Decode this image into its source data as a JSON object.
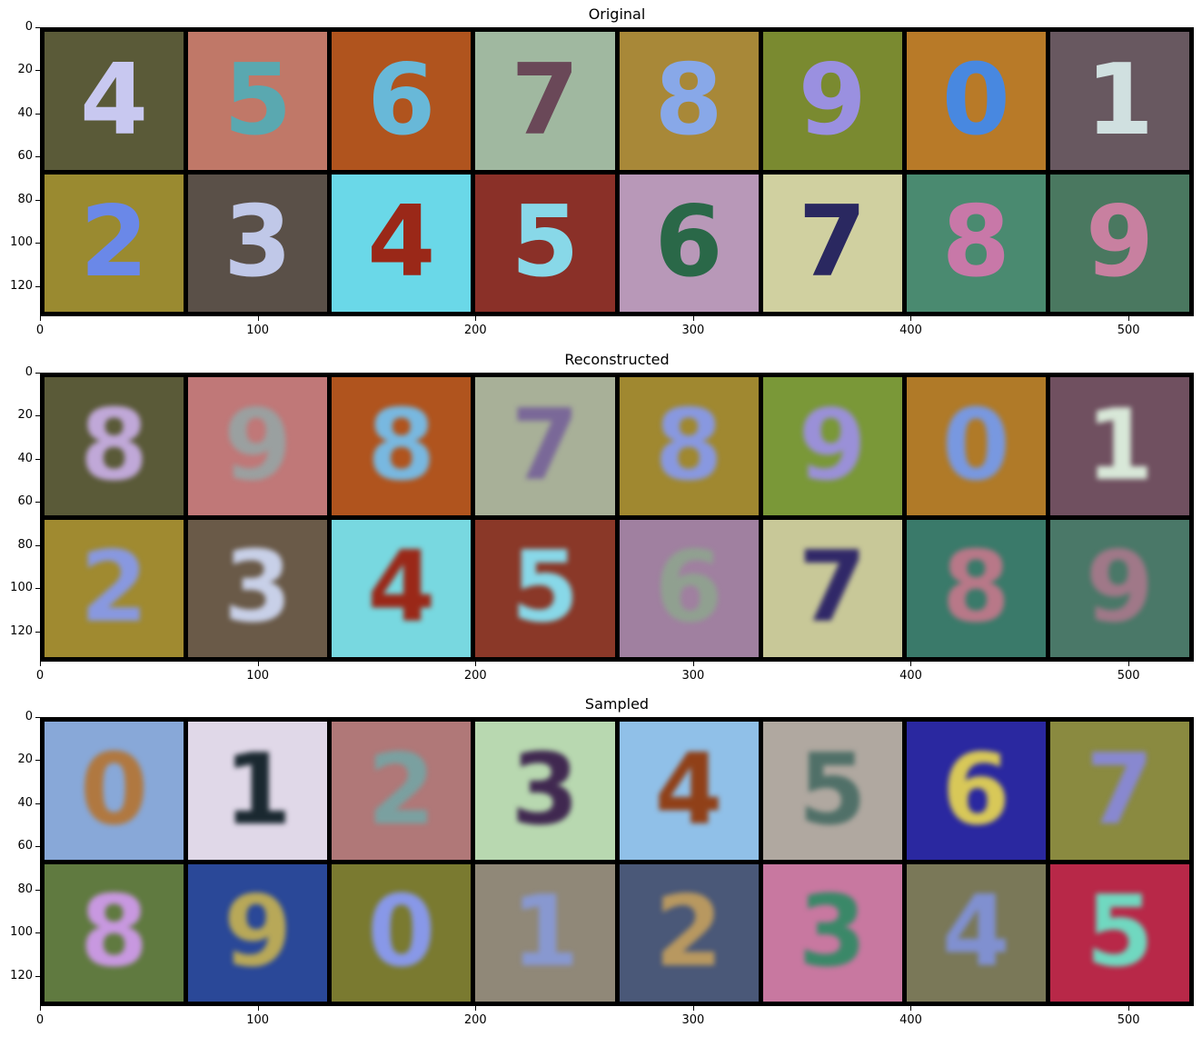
{
  "panels": [
    {
      "title": "Original",
      "y_ticks": [
        "0",
        "20",
        "40",
        "60",
        "80",
        "100",
        "120"
      ],
      "x_ticks": [
        "0",
        "100",
        "200",
        "300",
        "400",
        "500"
      ],
      "tiles": [
        {
          "digit": "4",
          "bg": "#5a5a38",
          "fg": "#c8c8f0"
        },
        {
          "digit": "5",
          "bg": "#c07868",
          "fg": "#5aa8b0"
        },
        {
          "digit": "6",
          "bg": "#b0541e",
          "fg": "#68b8d8"
        },
        {
          "digit": "7",
          "bg": "#a0b8a0",
          "fg": "#6a4858"
        },
        {
          "digit": "8",
          "bg": "#a88838",
          "fg": "#88a8e8"
        },
        {
          "digit": "9",
          "bg": "#7a8a30",
          "fg": "#9a90e0"
        },
        {
          "digit": "0",
          "bg": "#b87a28",
          "fg": "#4888e0"
        },
        {
          "digit": "1",
          "bg": "#685860",
          "fg": "#d0e0e0"
        },
        {
          "digit": "2",
          "bg": "#9a8a30",
          "fg": "#6a88e8"
        },
        {
          "digit": "3",
          "bg": "#5a5048",
          "fg": "#c0c8e8"
        },
        {
          "digit": "4",
          "bg": "#6ad8e8",
          "fg": "#9a2818"
        },
        {
          "digit": "5",
          "bg": "#8a3028",
          "fg": "#88d8e8"
        },
        {
          "digit": "6",
          "bg": "#b898b8",
          "fg": "#2a6848"
        },
        {
          "digit": "7",
          "bg": "#d0d0a0",
          "fg": "#2a2860"
        },
        {
          "digit": "8",
          "bg": "#4a8a70",
          "fg": "#c878a8"
        },
        {
          "digit": "9",
          "bg": "#4a7860",
          "fg": "#c880a0"
        }
      ]
    },
    {
      "title": "Reconstructed",
      "y_ticks": [
        "0",
        "20",
        "40",
        "60",
        "80",
        "100",
        "120"
      ],
      "x_ticks": [
        "0",
        "100",
        "200",
        "300",
        "400",
        "500"
      ],
      "tiles": [
        {
          "digit": "8",
          "bg": "#5a5a38",
          "fg": "#c0a8d8"
        },
        {
          "digit": "9",
          "bg": "#c07878",
          "fg": "#9aa0a0"
        },
        {
          "digit": "8",
          "bg": "#b0541e",
          "fg": "#78b8e0"
        },
        {
          "digit": "7",
          "bg": "#a8b098",
          "fg": "#7a6898"
        },
        {
          "digit": "8",
          "bg": "#a08830",
          "fg": "#8898e0"
        },
        {
          "digit": "9",
          "bg": "#7a9838",
          "fg": "#9a90d8"
        },
        {
          "digit": "0",
          "bg": "#b07a28",
          "fg": "#7898e0"
        },
        {
          "digit": "1",
          "bg": "#705060",
          "fg": "#d8e8d8"
        },
        {
          "digit": "2",
          "bg": "#a08a30",
          "fg": "#8898e0"
        },
        {
          "digit": "3",
          "bg": "#6a5a48",
          "fg": "#c8d0e8"
        },
        {
          "digit": "4",
          "bg": "#78d8e0",
          "fg": "#9a2818"
        },
        {
          "digit": "5",
          "bg": "#8a3828",
          "fg": "#88d8e8"
        },
        {
          "digit": "6",
          "bg": "#a080a0",
          "fg": "#90a090"
        },
        {
          "digit": "7",
          "bg": "#c8c898",
          "fg": "#302868"
        },
        {
          "digit": "8",
          "bg": "#3a7a6a",
          "fg": "#b87888"
        },
        {
          "digit": "9",
          "bg": "#4a7868",
          "fg": "#a07888"
        }
      ]
    },
    {
      "title": "Sampled",
      "y_ticks": [
        "0",
        "20",
        "40",
        "60",
        "80",
        "100",
        "120"
      ],
      "x_ticks": [
        "0",
        "100",
        "200",
        "300",
        "400",
        "500"
      ],
      "tiles": [
        {
          "digit": "0",
          "bg": "#88a8d8",
          "fg": "#b07840"
        },
        {
          "digit": "1",
          "bg": "#e0d8e8",
          "fg": "#1a2830"
        },
        {
          "digit": "2",
          "bg": "#b07878",
          "fg": "#7aa0a0"
        },
        {
          "digit": "3",
          "bg": "#b8d8b0",
          "fg": "#402850"
        },
        {
          "digit": "4",
          "bg": "#90c0e8",
          "fg": "#904018"
        },
        {
          "digit": "5",
          "bg": "#b0a8a0",
          "fg": "#507068"
        },
        {
          "digit": "6",
          "bg": "#2a28a0",
          "fg": "#d8c858"
        },
        {
          "digit": "7",
          "bg": "#8a8a40",
          "fg": "#8888d0"
        },
        {
          "digit": "8",
          "bg": "#607a40",
          "fg": "#c898e0"
        },
        {
          "digit": "9",
          "bg": "#2a4898",
          "fg": "#b8a858"
        },
        {
          "digit": "0",
          "bg": "#7a7a30",
          "fg": "#8898e8"
        },
        {
          "digit": "1",
          "bg": "#908878",
          "fg": "#8898d0"
        },
        {
          "digit": "2",
          "bg": "#4a5878",
          "fg": "#b89860"
        },
        {
          "digit": "3",
          "bg": "#c878a0",
          "fg": "#3a8868"
        },
        {
          "digit": "4",
          "bg": "#7a7858",
          "fg": "#8090d0"
        },
        {
          "digit": "5",
          "bg": "#b82848",
          "fg": "#70d8c0"
        }
      ]
    }
  ]
}
